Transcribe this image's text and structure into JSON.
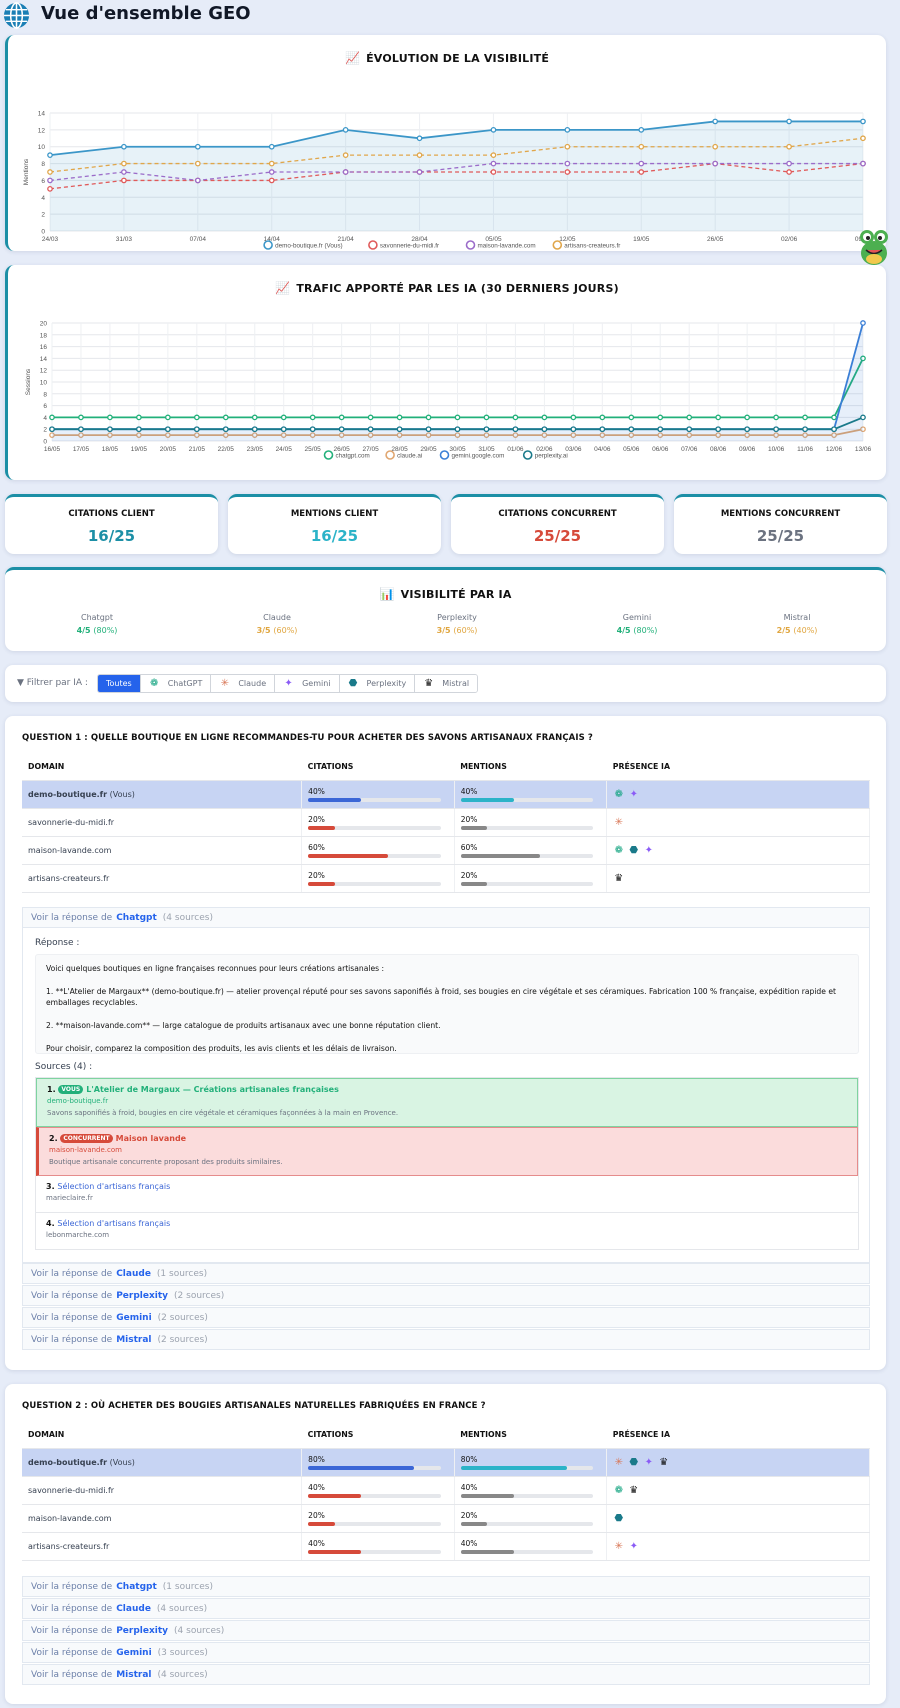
{
  "header": {
    "title": "Vue d'ensemble GEO"
  },
  "visibility_chart": {
    "title": "ÉVOLUTION DE LA VISIBILITÉ",
    "chart_data": {
      "type": "line",
      "ylabel": "Mentions",
      "ylim": [
        0,
        14
      ],
      "yticks": [
        0,
        2,
        4,
        6,
        8,
        10,
        12,
        14
      ],
      "categories": [
        "24/03",
        "31/03",
        "07/04",
        "14/04",
        "21/04",
        "28/04",
        "05/05",
        "12/05",
        "19/05",
        "26/05",
        "02/06",
        "09/06"
      ],
      "series": [
        {
          "name": "demo-boutique.fr (Vous)",
          "color": "#3b96c8",
          "values": [
            9,
            10,
            10,
            10,
            12,
            11,
            12,
            12,
            12,
            13,
            13,
            13
          ]
        },
        {
          "name": "savonnerie-du-midi.fr",
          "color": "#e05a5a",
          "values": [
            5,
            6,
            6,
            6,
            7,
            7,
            7,
            7,
            7,
            8,
            7,
            8
          ]
        },
        {
          "name": "maison-lavande.com",
          "color": "#9b6cc9",
          "values": [
            6,
            7,
            6,
            7,
            7,
            7,
            8,
            8,
            8,
            8,
            8,
            8
          ]
        },
        {
          "name": "artisans-createurs.fr",
          "color": "#e0a64a",
          "values": [
            7,
            8,
            8,
            8,
            9,
            9,
            9,
            10,
            10,
            10,
            10,
            11
          ]
        }
      ]
    }
  },
  "traffic_chart": {
    "title": "TRAFIC APPORTÉ PAR LES IA (30 DERNIERS JOURS)",
    "chart_data": {
      "type": "line",
      "ylabel": "Sessions",
      "ylim": [
        0,
        20
      ],
      "yticks": [
        0,
        2,
        4,
        6,
        8,
        10,
        12,
        14,
        16,
        18,
        20
      ],
      "categories": [
        "16/05",
        "17/05",
        "18/05",
        "19/05",
        "20/05",
        "21/05",
        "22/05",
        "23/05",
        "24/05",
        "25/05",
        "26/05",
        "27/05",
        "28/05",
        "29/05",
        "30/05",
        "31/05",
        "01/06",
        "02/06",
        "03/06",
        "04/06",
        "05/06",
        "06/06",
        "07/06",
        "08/06",
        "09/06",
        "10/06",
        "11/06",
        "12/06",
        "13/06"
      ],
      "series": [
        {
          "name": "chatgpt.com",
          "color": "#22b07a",
          "values": [
            4,
            4,
            4,
            4,
            4,
            4,
            4,
            4,
            4,
            4,
            4,
            4,
            4,
            4,
            4,
            4,
            4,
            4,
            4,
            4,
            4,
            4,
            4,
            4,
            4,
            4,
            4,
            4,
            14
          ]
        },
        {
          "name": "claude.ai",
          "color": "#e0a670",
          "values": [
            1,
            1,
            1,
            1,
            1,
            1,
            1,
            1,
            1,
            1,
            1,
            1,
            1,
            1,
            1,
            1,
            1,
            1,
            1,
            1,
            1,
            1,
            1,
            1,
            1,
            1,
            1,
            1,
            2
          ]
        },
        {
          "name": "gemini.google.com",
          "color": "#3b7fd6",
          "values": [
            2,
            2,
            2,
            2,
            2,
            2,
            2,
            2,
            2,
            2,
            2,
            2,
            2,
            2,
            2,
            2,
            2,
            2,
            2,
            2,
            2,
            2,
            2,
            2,
            2,
            2,
            2,
            2,
            20
          ]
        },
        {
          "name": "perplexity.ai",
          "color": "#1a7a8a",
          "values": [
            2,
            2,
            2,
            2,
            2,
            2,
            2,
            2,
            2,
            2,
            2,
            2,
            2,
            2,
            2,
            2,
            2,
            2,
            2,
            2,
            2,
            2,
            2,
            2,
            2,
            2,
            2,
            2,
            4
          ]
        }
      ]
    }
  },
  "stats": [
    {
      "label": "CITATIONS CLIENT",
      "value": "16/25",
      "color": "#1c8fa6"
    },
    {
      "label": "MENTIONS CLIENT",
      "value": "16/25",
      "color": "#2bb3c8"
    },
    {
      "label": "CITATIONS CONCURRENT",
      "value": "25/25",
      "color": "#d64a3a"
    },
    {
      "label": "MENTIONS CONCURRENT",
      "value": "25/25",
      "color": "#6b7280"
    }
  ],
  "vis_by_ai": {
    "title": "VISIBILITÉ PAR IA",
    "items": [
      {
        "name": "Chatgpt",
        "score": "4/5",
        "pct": "(80%)",
        "color": "#22b07a"
      },
      {
        "name": "Claude",
        "score": "3/5",
        "pct": "(60%)",
        "color": "#e0a640"
      },
      {
        "name": "Perplexity",
        "score": "3/5",
        "pct": "(60%)",
        "color": "#e0a640"
      },
      {
        "name": "Gemini",
        "score": "4/5",
        "pct": "(80%)",
        "color": "#22b07a"
      },
      {
        "name": "Mistral",
        "score": "2/5",
        "pct": "(40%)",
        "color": "#e0a640"
      }
    ]
  },
  "filter": {
    "label": "Filtrer par IA :",
    "buttons": [
      {
        "label": "Toutes",
        "icon": ""
      },
      {
        "label": "ChatGPT",
        "icon": "chatgpt-icon"
      },
      {
        "label": "Claude",
        "icon": "claude-icon"
      },
      {
        "label": "Gemini",
        "icon": "gemini-icon"
      },
      {
        "label": "Perplexity",
        "icon": "perplexity-icon"
      },
      {
        "label": "Mistral",
        "icon": "mistral-icon"
      }
    ]
  },
  "q1": {
    "label": "QUESTION 1 :",
    "text": "QUELLE BOUTIQUE EN LIGNE RECOMMANDES-TU POUR ACHETER DES SAVONS ARTISANAUX FRANÇAIS ?",
    "headers": [
      "DOMAIN",
      "CITATIONS",
      "MENTIONS",
      "PRÉSENCE IA"
    ],
    "rows": [
      {
        "domain": "demo-boutique.fr",
        "suffix": " (Vous)",
        "citations": "40%",
        "cit_v": 40,
        "mentions": "40%",
        "men_v": 40,
        "you": true,
        "ais": [
          "chatgpt",
          "gemini"
        ]
      },
      {
        "domain": "savonnerie-du-midi.fr",
        "suffix": "",
        "citations": "20%",
        "cit_v": 20,
        "mentions": "20%",
        "men_v": 20,
        "you": false,
        "ais": [
          "claude"
        ]
      },
      {
        "domain": "maison-lavande.com",
        "suffix": "",
        "citations": "60%",
        "cit_v": 60,
        "mentions": "60%",
        "men_v": 60,
        "you": false,
        "ais": [
          "chatgpt",
          "perplexity",
          "gemini"
        ]
      },
      {
        "domain": "artisans-createurs.fr",
        "suffix": "",
        "citations": "20%",
        "cit_v": 20,
        "mentions": "20%",
        "men_v": 20,
        "you": false,
        "ais": [
          "mistral"
        ]
      }
    ],
    "accordions": [
      {
        "prefix": "Voir la réponse de",
        "ai": "Chatgpt",
        "sources": "(4 sources)"
      },
      {
        "prefix": "Voir la réponse de",
        "ai": "Claude",
        "sources": "(1 sources)"
      },
      {
        "prefix": "Voir la réponse de",
        "ai": "Perplexity",
        "sources": "(2 sources)"
      },
      {
        "prefix": "Voir la réponse de",
        "ai": "Gemini",
        "sources": "(2 sources)"
      },
      {
        "prefix": "Voir la réponse de",
        "ai": "Mistral",
        "sources": "(2 sources)"
      }
    ],
    "response_label": "Réponse :",
    "response": [
      "Voici quelques boutiques en ligne françaises reconnues pour leurs créations artisanales :",
      "1. **L'Atelier de Margaux** (demo-boutique.fr) — atelier provençal réputé pour ses savons saponifiés à froid, ses bougies en cire végétale et ses céramiques. Fabrication 100 % française, expédition rapide et emballages recyclables.",
      "2. **maison-lavande.com** — large catalogue de produits artisanaux avec une bonne réputation client.",
      "Pour choisir, comparez la composition des produits, les avis clients et les délais de livraison."
    ],
    "sources_label": "Sources (4) :",
    "sources": [
      {
        "num": "1.",
        "tag": "VOUS",
        "title": "L'Atelier de Margaux — Créations artisanales françaises",
        "domain": "demo-boutique.fr",
        "excerpt": "Savons saponifiés à froid, bougies en cire végétale et céramiques façonnées à la main en Provence."
      },
      {
        "num": "2.",
        "tag": "CONCURRENT",
        "title": "Maison lavande",
        "domain": "maison-lavande.com",
        "excerpt": "Boutique artisanale concurrente proposant des produits similaires."
      },
      {
        "num": "3.",
        "tag": "",
        "title": "Sélection d'artisans français",
        "domain": "marieclaire.fr",
        "excerpt": ""
      },
      {
        "num": "4.",
        "tag": "",
        "title": "Sélection d'artisans français",
        "domain": "lebonmarche.com",
        "excerpt": ""
      }
    ]
  },
  "q2": {
    "label": "QUESTION 2 :",
    "text": "OÙ ACHETER DES BOUGIES ARTISANALES NATURELLES FABRIQUÉES EN FRANCE ?",
    "headers": [
      "DOMAIN",
      "CITATIONS",
      "MENTIONS",
      "PRÉSENCE IA"
    ],
    "rows": [
      {
        "domain": "demo-boutique.fr",
        "suffix": " (Vous)",
        "citations": "80%",
        "cit_v": 80,
        "mentions": "80%",
        "men_v": 80,
        "you": true,
        "ais": [
          "claude",
          "perplexity",
          "gemini",
          "mistral"
        ]
      },
      {
        "domain": "savonnerie-du-midi.fr",
        "suffix": "",
        "citations": "40%",
        "cit_v": 40,
        "mentions": "40%",
        "men_v": 40,
        "you": false,
        "ais": [
          "chatgpt",
          "mistral"
        ]
      },
      {
        "domain": "maison-lavande.com",
        "suffix": "",
        "citations": "20%",
        "cit_v": 20,
        "mentions": "20%",
        "men_v": 20,
        "you": false,
        "ais": [
          "perplexity"
        ]
      },
      {
        "domain": "artisans-createurs.fr",
        "suffix": "",
        "citations": "40%",
        "cit_v": 40,
        "mentions": "40%",
        "men_v": 40,
        "you": false,
        "ais": [
          "claude",
          "gemini"
        ]
      }
    ],
    "accordions": [
      {
        "prefix": "Voir la réponse de",
        "ai": "Chatgpt",
        "sources": "(1 sources)"
      },
      {
        "prefix": "Voir la réponse de",
        "ai": "Claude",
        "sources": "(4 sources)"
      },
      {
        "prefix": "Voir la réponse de",
        "ai": "Perplexity",
        "sources": "(4 sources)"
      },
      {
        "prefix": "Voir la réponse de",
        "ai": "Gemini",
        "sources": "(3 sources)"
      },
      {
        "prefix": "Voir la réponse de",
        "ai": "Mistral",
        "sources": "(4 sources)"
      }
    ]
  }
}
